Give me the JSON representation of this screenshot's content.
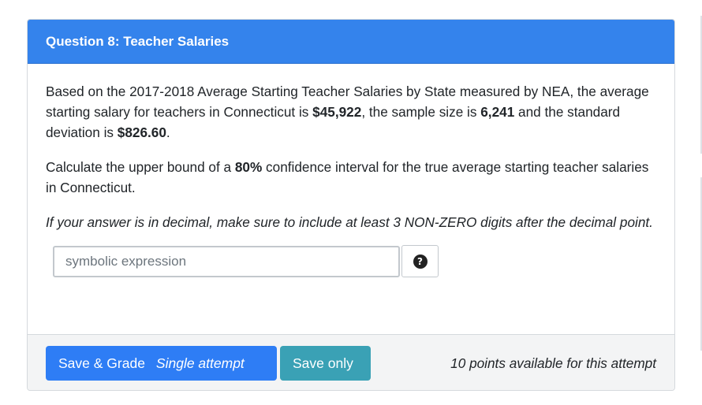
{
  "question": {
    "title": "Question 8: Teacher Salaries"
  },
  "body": {
    "p1_a": "Based on the 2017-2018 Average Starting Teacher Salaries by State measured by NEA, the average starting salary for teachers in Connecticut is ",
    "mean": "$45,922",
    "p1_b": ", the sample size is ",
    "n": "6,241",
    "p1_c": " and the standard deviation is ",
    "sd": "$826.60",
    "p1_d": ".",
    "p2_a": "Calculate the upper bound of a ",
    "confidence": "80%",
    "p2_b": " confidence interval for the true average starting teacher salaries in Connecticut.",
    "note": "If your answer is in decimal, make sure to include at least 3 NON-ZERO digits after the decimal point."
  },
  "answer": {
    "placeholder": "symbolic expression",
    "value": "",
    "help_icon": "question-circle-icon",
    "help_glyph": "?"
  },
  "footer": {
    "save_grade_label": "Save & Grade",
    "attempt_label": "Single attempt",
    "save_only_label": "Save only",
    "points_text": "10 points available for this attempt"
  },
  "colors": {
    "header_bg": "#3483ec",
    "primary_button": "#2e7df5",
    "info_button": "#3aa1b5",
    "footer_bg": "#f3f4f5"
  }
}
